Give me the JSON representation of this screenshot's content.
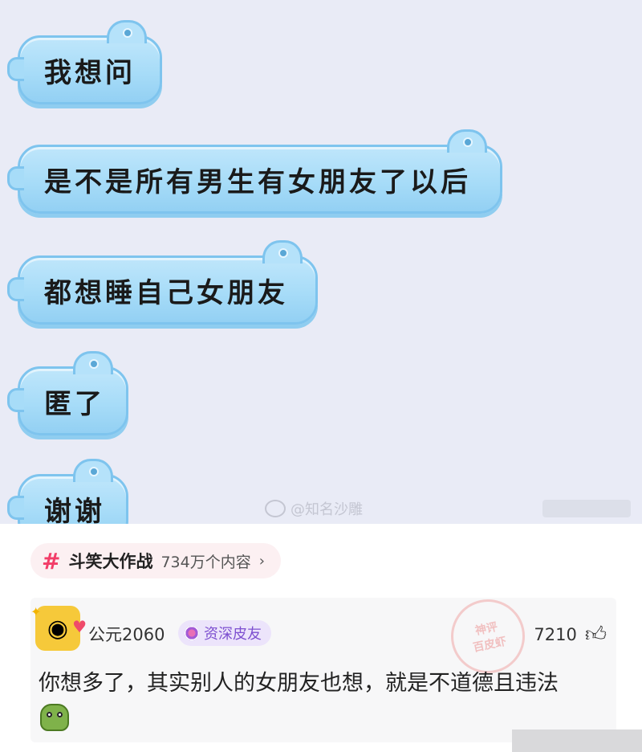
{
  "chat": {
    "messages": [
      "我想问",
      "是不是所有男生有女朋友了以后",
      "都想睡自己女朋友",
      "匿了",
      "谢谢"
    ],
    "watermark": "@知名沙雕"
  },
  "topic": {
    "icon": "#",
    "name": "斗笑大作战",
    "count": "734万个内容",
    "arrow": "›"
  },
  "comment": {
    "username": "公元2060",
    "badge": "资深皮友",
    "likes": "7210",
    "text": "你想多了，其实别人的女朋友也想，就是不道德且违法",
    "stamp_line1": "神评",
    "stamp_line2": "百皮虾"
  },
  "colors": {
    "bubble": "#a7dcf8",
    "chat_bg": "#e9ebf6",
    "topic_accent": "#f23d68",
    "badge_text": "#7d4fd0"
  }
}
